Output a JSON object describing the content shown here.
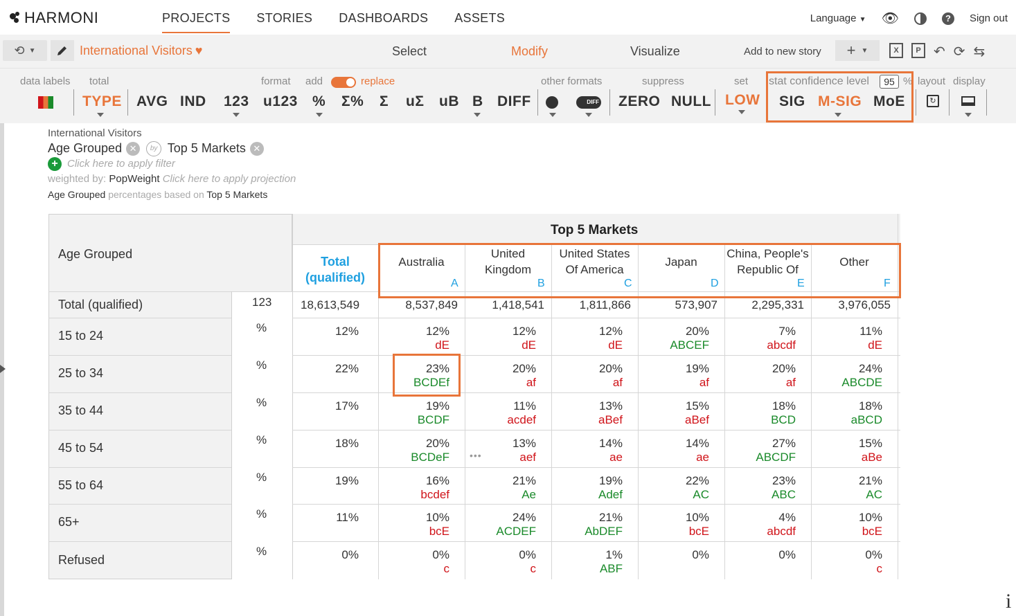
{
  "app": {
    "logo_text": "HARMONI",
    "nav": [
      "PROJECTS",
      "STORIES",
      "DASHBOARDS",
      "ASSETS"
    ],
    "active_nav": "PROJECTS",
    "language_label": "Language",
    "signout_label": "Sign out"
  },
  "subbar": {
    "report_title": "International Visitors",
    "modes": [
      "Select",
      "Modify",
      "Visualize"
    ],
    "active_mode": "Modify",
    "add_story_label": "Add to new story"
  },
  "toolbar": {
    "labels": {
      "data_labels": "data labels",
      "total": "total",
      "format": "format",
      "add": "add",
      "replace": "replace",
      "other_formats": "other formats",
      "suppress": "suppress",
      "set": "set",
      "stat_confidence": "stat confidence level",
      "percent_sign": "%",
      "layout": "layout",
      "display": "display"
    },
    "confidence_value": "95",
    "buttons": {
      "type": "TYPE",
      "avg": "AVG",
      "ind": "IND",
      "n123": "123",
      "u123": "u123",
      "pct": "%",
      "sigma_pct": "Σ%",
      "sigma": "Σ",
      "u_sigma": "uΣ",
      "ub": "uB",
      "b": "B",
      "diff": "DIFF",
      "zero": "ZERO",
      "null": "NULL",
      "low": "LOW",
      "sig": "SIG",
      "msig": "M-SIG",
      "moe": "MoE"
    }
  },
  "meta": {
    "subtitle": "International Visitors",
    "row_var": "Age Grouped",
    "col_var": "Top 5 Markets",
    "filter_hint": "Click here to apply filter",
    "weighted_prefix": "weighted by:",
    "weight_var": "PopWeight",
    "projection_hint": "Click here to apply projection",
    "pct_base_row": "Age Grouped",
    "pct_base_mid": "percentages based on",
    "pct_base_col": "Top 5 Markets"
  },
  "table": {
    "stub_header": "Age Grouped",
    "banner": "Top 5 Markets",
    "total_header_line1": "Total",
    "total_header_line2": "(qualified)",
    "columns": [
      {
        "l1": "Australia",
        "l2": "",
        "letter": "A"
      },
      {
        "l1": "United",
        "l2": "Kingdom",
        "letter": "B"
      },
      {
        "l1": "United States",
        "l2": "Of America",
        "letter": "C"
      },
      {
        "l1": "Japan",
        "l2": "",
        "letter": "D"
      },
      {
        "l1": "China, People's",
        "l2": "Republic Of",
        "letter": "E"
      },
      {
        "l1": "Other",
        "l2": "",
        "letter": "F"
      }
    ],
    "total_row": {
      "label": "Total (qualified)",
      "format": "123",
      "total": "18,613,549",
      "values": [
        "8,537,849",
        "1,418,541",
        "1,811,866",
        "573,907",
        "2,295,331",
        "3,976,055"
      ]
    },
    "rows": [
      {
        "label": "15 to 24",
        "format": "%",
        "total": "12%",
        "values": [
          "12%",
          "12%",
          "12%",
          "20%",
          "7%",
          "11%"
        ],
        "sig": [
          "dE",
          "dE",
          "dE",
          "ABCEF",
          "abcdf",
          "dE"
        ],
        "sig_color": [
          "red",
          "red",
          "red",
          "green",
          "red",
          "red"
        ]
      },
      {
        "label": "25 to 34",
        "format": "%",
        "total": "22%",
        "values": [
          "23%",
          "20%",
          "20%",
          "19%",
          "20%",
          "24%"
        ],
        "sig": [
          "BCDEf",
          "af",
          "af",
          "af",
          "af",
          "ABCDE"
        ],
        "sig_color": [
          "green",
          "red",
          "red",
          "red",
          "red",
          "green"
        ]
      },
      {
        "label": "35 to 44",
        "format": "%",
        "total": "17%",
        "values": [
          "19%",
          "11%",
          "13%",
          "15%",
          "18%",
          "18%"
        ],
        "sig": [
          "BCDF",
          "acdef",
          "aBef",
          "aBef",
          "BCD",
          "aBCD"
        ],
        "sig_color": [
          "green",
          "red",
          "red",
          "red",
          "green",
          "green"
        ]
      },
      {
        "label": "45 to 54",
        "format": "%",
        "total": "18%",
        "values": [
          "20%",
          "13%",
          "14%",
          "14%",
          "27%",
          "15%"
        ],
        "sig": [
          "BCDeF",
          "aef",
          "ae",
          "ae",
          "ABCDF",
          "aBe"
        ],
        "sig_color": [
          "green",
          "red",
          "red",
          "red",
          "green",
          "red"
        ]
      },
      {
        "label": "55 to 64",
        "format": "%",
        "total": "19%",
        "values": [
          "16%",
          "21%",
          "19%",
          "22%",
          "23%",
          "21%"
        ],
        "sig": [
          "bcdef",
          "Ae",
          "Adef",
          "AC",
          "ABC",
          "AC"
        ],
        "sig_color": [
          "red",
          "green",
          "green",
          "green",
          "green",
          "green"
        ]
      },
      {
        "label": "65+",
        "format": "%",
        "total": "11%",
        "values": [
          "10%",
          "24%",
          "21%",
          "10%",
          "4%",
          "10%"
        ],
        "sig": [
          "bcE",
          "ACDEF",
          "AbDEF",
          "bcE",
          "abcdf",
          "bcE"
        ],
        "sig_color": [
          "red",
          "green",
          "green",
          "red",
          "red",
          "red"
        ]
      },
      {
        "label": "Refused",
        "format": "%",
        "total": "0%",
        "values": [
          "0%",
          "0%",
          "1%",
          "0%",
          "0%",
          "0%"
        ],
        "sig": [
          "c",
          "c",
          "ABF",
          "",
          "",
          "c"
        ],
        "sig_color": [
          "red",
          "red",
          "green",
          "red",
          "red",
          "red"
        ]
      }
    ]
  },
  "colors": {
    "accent": "#e8753a",
    "sig_positive": "#1a8a2a",
    "sig_negative": "#d0141a",
    "column_letter": "#1fa0e0"
  }
}
